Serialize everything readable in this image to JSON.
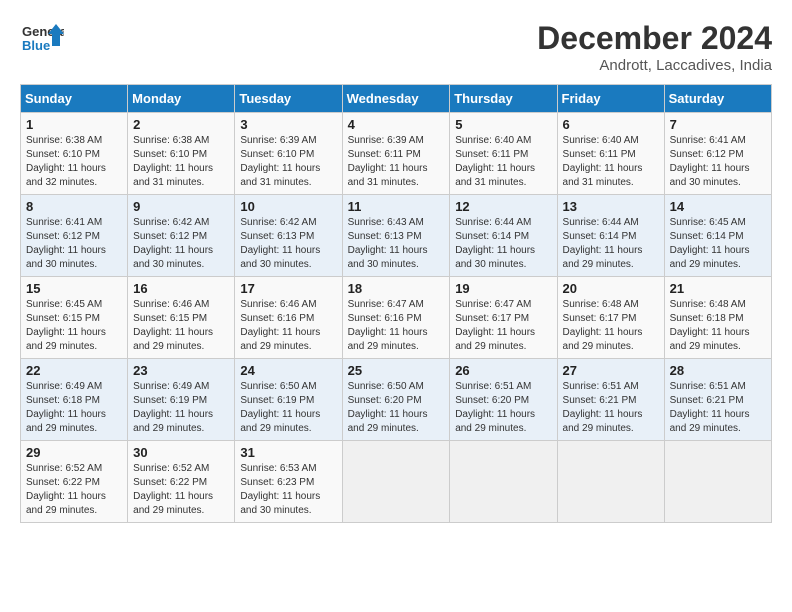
{
  "logo": {
    "line1": "General",
    "line2": "Blue"
  },
  "title": "December 2024",
  "location": "Andrott, Laccadives, India",
  "headers": [
    "Sunday",
    "Monday",
    "Tuesday",
    "Wednesday",
    "Thursday",
    "Friday",
    "Saturday"
  ],
  "weeks": [
    [
      {
        "day": "1",
        "sunrise": "6:38 AM",
        "sunset": "6:10 PM",
        "daylight": "11 hours and 32 minutes."
      },
      {
        "day": "2",
        "sunrise": "6:38 AM",
        "sunset": "6:10 PM",
        "daylight": "11 hours and 31 minutes."
      },
      {
        "day": "3",
        "sunrise": "6:39 AM",
        "sunset": "6:10 PM",
        "daylight": "11 hours and 31 minutes."
      },
      {
        "day": "4",
        "sunrise": "6:39 AM",
        "sunset": "6:11 PM",
        "daylight": "11 hours and 31 minutes."
      },
      {
        "day": "5",
        "sunrise": "6:40 AM",
        "sunset": "6:11 PM",
        "daylight": "11 hours and 31 minutes."
      },
      {
        "day": "6",
        "sunrise": "6:40 AM",
        "sunset": "6:11 PM",
        "daylight": "11 hours and 31 minutes."
      },
      {
        "day": "7",
        "sunrise": "6:41 AM",
        "sunset": "6:12 PM",
        "daylight": "11 hours and 30 minutes."
      }
    ],
    [
      {
        "day": "8",
        "sunrise": "6:41 AM",
        "sunset": "6:12 PM",
        "daylight": "11 hours and 30 minutes."
      },
      {
        "day": "9",
        "sunrise": "6:42 AM",
        "sunset": "6:12 PM",
        "daylight": "11 hours and 30 minutes."
      },
      {
        "day": "10",
        "sunrise": "6:42 AM",
        "sunset": "6:13 PM",
        "daylight": "11 hours and 30 minutes."
      },
      {
        "day": "11",
        "sunrise": "6:43 AM",
        "sunset": "6:13 PM",
        "daylight": "11 hours and 30 minutes."
      },
      {
        "day": "12",
        "sunrise": "6:44 AM",
        "sunset": "6:14 PM",
        "daylight": "11 hours and 30 minutes."
      },
      {
        "day": "13",
        "sunrise": "6:44 AM",
        "sunset": "6:14 PM",
        "daylight": "11 hours and 29 minutes."
      },
      {
        "day": "14",
        "sunrise": "6:45 AM",
        "sunset": "6:14 PM",
        "daylight": "11 hours and 29 minutes."
      }
    ],
    [
      {
        "day": "15",
        "sunrise": "6:45 AM",
        "sunset": "6:15 PM",
        "daylight": "11 hours and 29 minutes."
      },
      {
        "day": "16",
        "sunrise": "6:46 AM",
        "sunset": "6:15 PM",
        "daylight": "11 hours and 29 minutes."
      },
      {
        "day": "17",
        "sunrise": "6:46 AM",
        "sunset": "6:16 PM",
        "daylight": "11 hours and 29 minutes."
      },
      {
        "day": "18",
        "sunrise": "6:47 AM",
        "sunset": "6:16 PM",
        "daylight": "11 hours and 29 minutes."
      },
      {
        "day": "19",
        "sunrise": "6:47 AM",
        "sunset": "6:17 PM",
        "daylight": "11 hours and 29 minutes."
      },
      {
        "day": "20",
        "sunrise": "6:48 AM",
        "sunset": "6:17 PM",
        "daylight": "11 hours and 29 minutes."
      },
      {
        "day": "21",
        "sunrise": "6:48 AM",
        "sunset": "6:18 PM",
        "daylight": "11 hours and 29 minutes."
      }
    ],
    [
      {
        "day": "22",
        "sunrise": "6:49 AM",
        "sunset": "6:18 PM",
        "daylight": "11 hours and 29 minutes."
      },
      {
        "day": "23",
        "sunrise": "6:49 AM",
        "sunset": "6:19 PM",
        "daylight": "11 hours and 29 minutes."
      },
      {
        "day": "24",
        "sunrise": "6:50 AM",
        "sunset": "6:19 PM",
        "daylight": "11 hours and 29 minutes."
      },
      {
        "day": "25",
        "sunrise": "6:50 AM",
        "sunset": "6:20 PM",
        "daylight": "11 hours and 29 minutes."
      },
      {
        "day": "26",
        "sunrise": "6:51 AM",
        "sunset": "6:20 PM",
        "daylight": "11 hours and 29 minutes."
      },
      {
        "day": "27",
        "sunrise": "6:51 AM",
        "sunset": "6:21 PM",
        "daylight": "11 hours and 29 minutes."
      },
      {
        "day": "28",
        "sunrise": "6:51 AM",
        "sunset": "6:21 PM",
        "daylight": "11 hours and 29 minutes."
      }
    ],
    [
      {
        "day": "29",
        "sunrise": "6:52 AM",
        "sunset": "6:22 PM",
        "daylight": "11 hours and 29 minutes."
      },
      {
        "day": "30",
        "sunrise": "6:52 AM",
        "sunset": "6:22 PM",
        "daylight": "11 hours and 29 minutes."
      },
      {
        "day": "31",
        "sunrise": "6:53 AM",
        "sunset": "6:23 PM",
        "daylight": "11 hours and 30 minutes."
      },
      null,
      null,
      null,
      null
    ]
  ],
  "labels": {
    "sunrise": "Sunrise: ",
    "sunset": "Sunset: ",
    "daylight": "Daylight: "
  }
}
